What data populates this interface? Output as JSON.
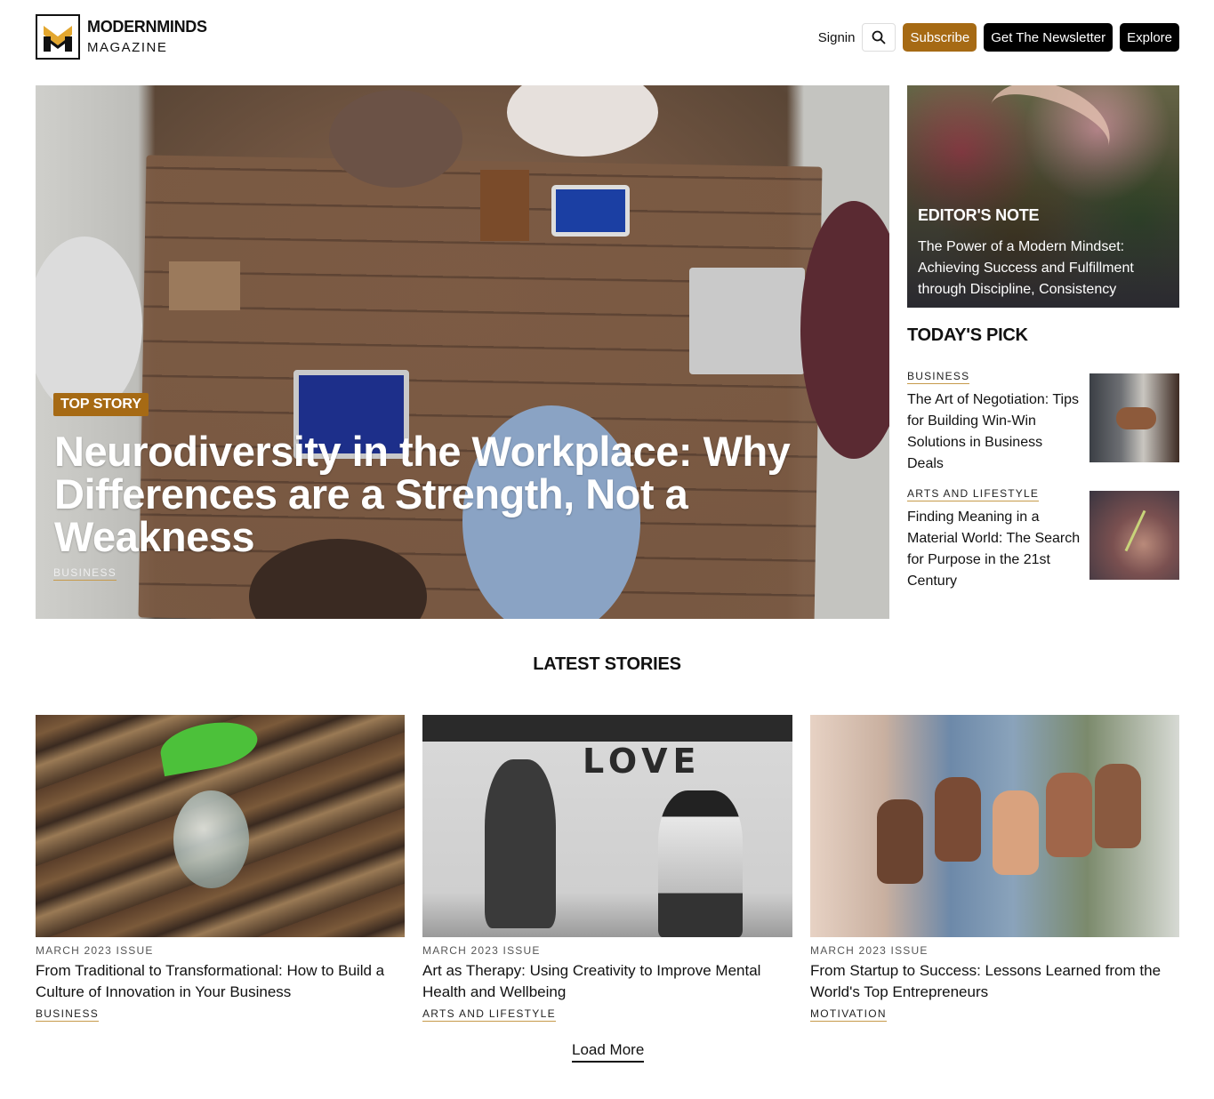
{
  "header": {
    "brand_name": "MODERNMINDS",
    "brand_sub": "MAGAZINE",
    "signin": "Signin",
    "subscribe": "Subscribe",
    "newsletter": "Get The Newsletter",
    "explore": "Explore",
    "accent_color": "#a66a14"
  },
  "hero": {
    "badge": "TOP STORY",
    "title": "Neurodiversity in the Workplace: Why Differences are a Strength, Not a Weakness",
    "category": "BUSINESS"
  },
  "editor_note": {
    "label": "EDITOR'S NOTE",
    "text": "The Power of a Modern Mindset: Achieving Success and Fulfillment through Discipline, Consistency"
  },
  "todays_pick": {
    "title": "TODAY'S PICK",
    "items": [
      {
        "category": "BUSINESS",
        "title": "The Art of Negotiation: Tips for Building Win-Win Solutions in Business Deals"
      },
      {
        "category": "ARTS AND LIFESTYLE",
        "title": "Finding Meaning in a Material World: The Search for Purpose in the 21st Century"
      }
    ]
  },
  "latest": {
    "title": "LATEST STORIES",
    "cards": [
      {
        "issue": "MARCH 2023 ISSUE",
        "title": "From Traditional to Transformational: How to Build a Culture of Innovation in Your Business",
        "category": "BUSINESS"
      },
      {
        "issue": "MARCH 2023 ISSUE",
        "title": "Art as Therapy: Using Creativity to Improve Mental Health and Wellbeing",
        "category": "ARTS AND LIFESTYLE",
        "image_text": "LOVE"
      },
      {
        "issue": "MARCH 2023 ISSUE",
        "title": "From Startup to Success: Lessons Learned from the World's Top Entrepreneurs",
        "category": "MOTIVATION"
      }
    ],
    "load_more": "Load More"
  }
}
